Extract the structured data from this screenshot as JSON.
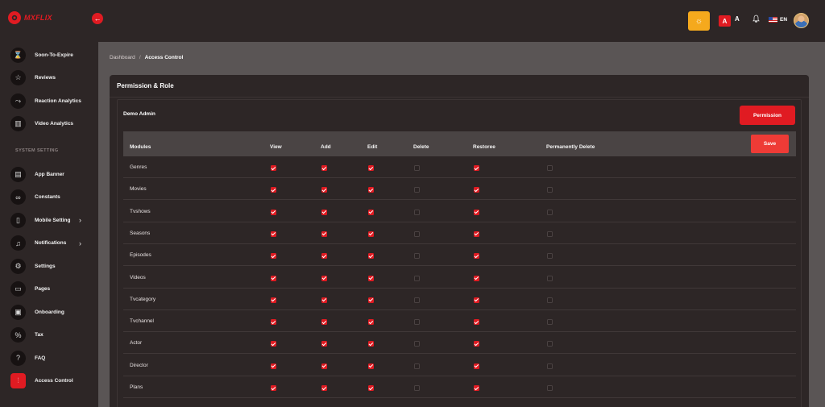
{
  "brand": {
    "name": "MXFLIX",
    "color": "#e01b22"
  },
  "sidebar": {
    "items": [
      {
        "label": "Soon-To-Expire",
        "icon": "hourglass-icon",
        "glyph": "⌛"
      },
      {
        "label": "Reviews",
        "icon": "star-icon",
        "glyph": "☆"
      },
      {
        "label": "Reaction Analytics",
        "icon": "line-chart-icon",
        "glyph": "⤳"
      },
      {
        "label": "Video Analytics",
        "icon": "bar-chart-icon",
        "glyph": "▥"
      }
    ],
    "section_label": "SYSTEM SETTING",
    "settings_items": [
      {
        "label": "App Banner",
        "icon": "banner-icon",
        "glyph": "▤",
        "chevron": false
      },
      {
        "label": "Constants",
        "icon": "infinity-icon",
        "glyph": "∞",
        "chevron": false
      },
      {
        "label": "Mobile Setting",
        "icon": "mobile-icon",
        "glyph": "▯",
        "chevron": true
      },
      {
        "label": "Notifications",
        "icon": "bell-icon",
        "glyph": "♫",
        "chevron": true
      },
      {
        "label": "Settings",
        "icon": "gear-icon",
        "glyph": "⚙",
        "chevron": false
      },
      {
        "label": "Pages",
        "icon": "page-icon",
        "glyph": "▭",
        "chevron": false
      },
      {
        "label": "Onboarding",
        "icon": "onboarding-icon",
        "glyph": "▣",
        "chevron": false
      },
      {
        "label": "Tax",
        "icon": "percent-icon",
        "glyph": "%",
        "chevron": false
      },
      {
        "label": "FAQ",
        "icon": "question-icon",
        "glyph": "?",
        "chevron": false
      },
      {
        "label": "Access Control",
        "icon": "sliders-icon",
        "glyph": "⫶",
        "chevron": false,
        "active": true
      }
    ]
  },
  "header": {
    "back_glyph": "←",
    "theme_glyph": "☼",
    "font_large": "A",
    "font_small": "A",
    "bell_glyph": "🔔",
    "language": "EN"
  },
  "breadcrumb": {
    "root": "Dashboard",
    "separator": "/",
    "current": "Access Control"
  },
  "card": {
    "title": "Permission & Role",
    "role_name": "Demo Admin",
    "permission_button": "Permission",
    "save_button": "Save"
  },
  "table": {
    "columns": [
      "Modules",
      "View",
      "Add",
      "Edit",
      "Delete",
      "Restoree",
      "Permanently Delete"
    ],
    "rows": [
      {
        "module": "Genres",
        "perms": [
          true,
          true,
          true,
          false,
          true,
          false
        ]
      },
      {
        "module": "Movies",
        "perms": [
          true,
          true,
          true,
          false,
          true,
          false
        ]
      },
      {
        "module": "Tvshows",
        "perms": [
          true,
          true,
          true,
          false,
          true,
          false
        ]
      },
      {
        "module": "Seasons",
        "perms": [
          true,
          true,
          true,
          false,
          true,
          false
        ]
      },
      {
        "module": "Episodes",
        "perms": [
          true,
          true,
          true,
          false,
          true,
          false
        ]
      },
      {
        "module": "Videos",
        "perms": [
          true,
          true,
          true,
          false,
          true,
          false
        ]
      },
      {
        "module": "Tvcategory",
        "perms": [
          true,
          true,
          true,
          false,
          true,
          false
        ]
      },
      {
        "module": "Tvchannel",
        "perms": [
          true,
          true,
          true,
          false,
          true,
          false
        ]
      },
      {
        "module": "Actor",
        "perms": [
          true,
          true,
          true,
          false,
          true,
          false
        ]
      },
      {
        "module": "Director",
        "perms": [
          true,
          true,
          true,
          false,
          true,
          false
        ]
      },
      {
        "module": "Plans",
        "perms": [
          true,
          true,
          true,
          false,
          true,
          false
        ]
      }
    ]
  }
}
